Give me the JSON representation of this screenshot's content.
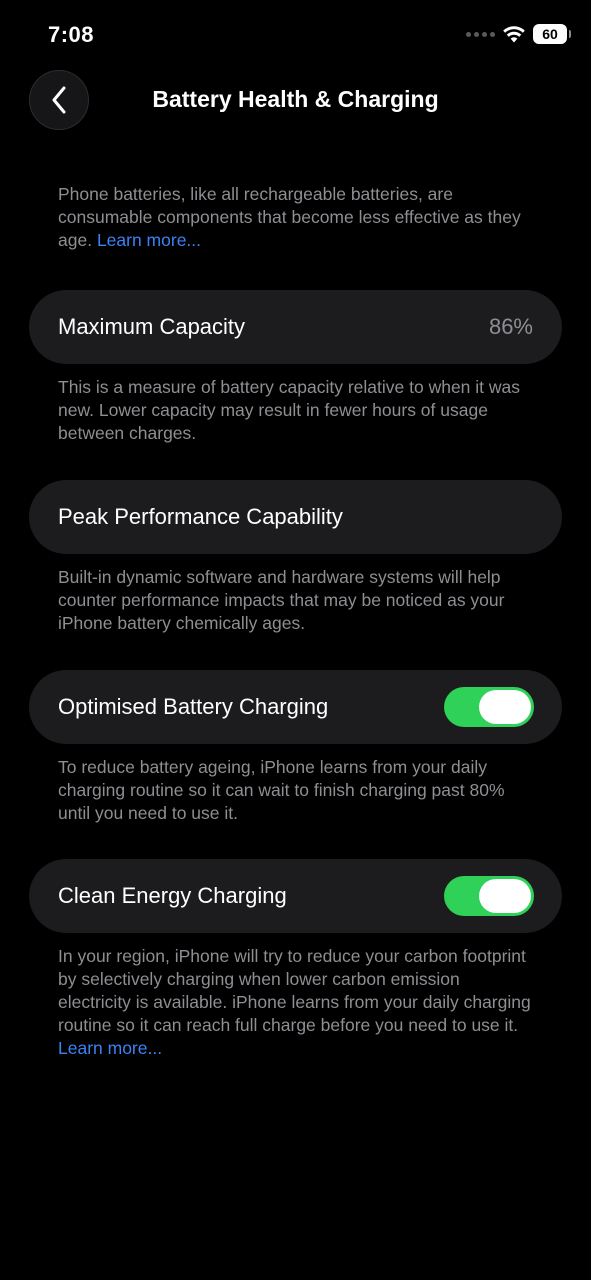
{
  "status_bar": {
    "time": "7:08",
    "battery_level": "60"
  },
  "nav": {
    "title": "Battery Health & Charging"
  },
  "intro": {
    "text": "Phone batteries, like all rechargeable batteries, are consumable components that become less effective as they age. ",
    "link": "Learn more..."
  },
  "max_capacity": {
    "label": "Maximum Capacity",
    "value": "86%",
    "footnote": "This is a measure of battery capacity relative to when it was new. Lower capacity may result in fewer hours of usage between charges."
  },
  "peak_performance": {
    "label": "Peak Performance Capability",
    "footnote": "Built-in dynamic software and hardware systems will help counter performance impacts that may be noticed as your iPhone battery chemically ages."
  },
  "optimised_charging": {
    "label": "Optimised Battery Charging",
    "enabled": true,
    "footnote": "To reduce battery ageing, iPhone learns from your daily charging routine so it can wait to finish charging past 80% until you need to use it."
  },
  "clean_energy": {
    "label": "Clean Energy Charging",
    "enabled": true,
    "footnote": "In your region, iPhone will try to reduce your carbon footprint by selectively charging when lower carbon emission electricity is available. iPhone learns from your daily charging routine so it can reach full charge before you need to use it. ",
    "link": "Learn more..."
  },
  "colors": {
    "background": "#000000",
    "card": "#1c1c1e",
    "secondary_text": "#8e8e93",
    "link": "#3b82f6",
    "toggle_on": "#30d158"
  },
  "icons": {
    "back": "chevron-left-icon",
    "wifi": "wifi-icon",
    "battery": "battery-icon",
    "signal": "cellular-signal-icon"
  }
}
